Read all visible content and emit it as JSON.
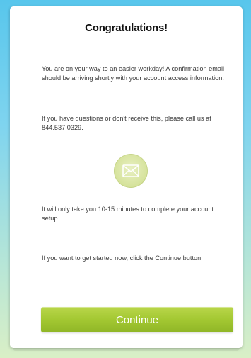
{
  "dialog": {
    "title": "Congratulations!",
    "paragraph_1": "You are on your way to an easier workday! A confirmation email should be arriving shortly with your account access information.",
    "paragraph_2": "If you have questions or don't receive this, please call us at 844.537.0329.",
    "icon": "envelope-icon",
    "paragraph_3": "It will only take you 10-15 minutes to complete your account setup.",
    "paragraph_4": "If you want to get started now, click the Continue button.",
    "continue_label": "Continue"
  },
  "colors": {
    "accent": "#a3c832",
    "icon_bg": "#d5e29a",
    "background_top": "#58c6ec",
    "background_bottom": "#d9efc6"
  }
}
